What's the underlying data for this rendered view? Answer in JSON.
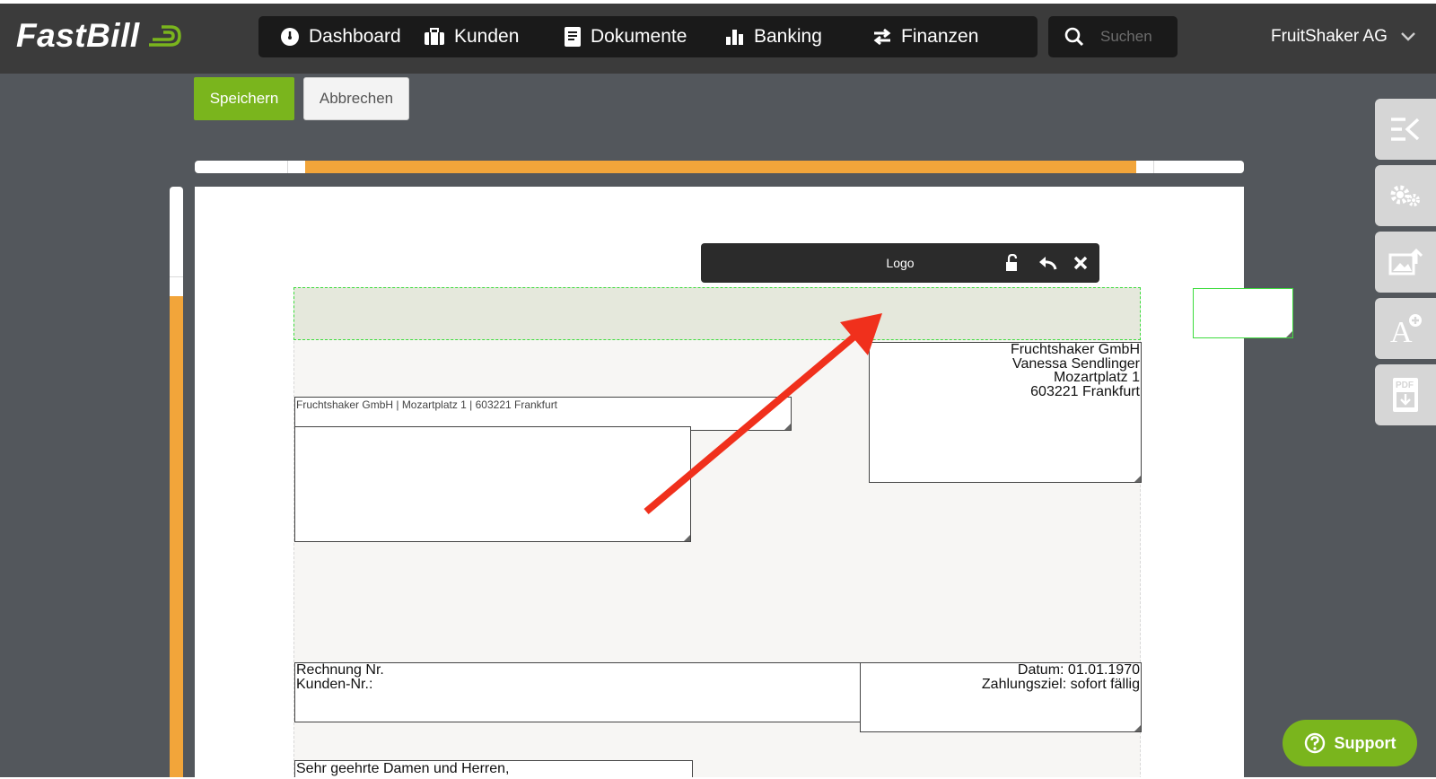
{
  "app": {
    "brand": "FastBill"
  },
  "nav": {
    "items": [
      {
        "label": "Dashboard",
        "icon": "dashboard-icon"
      },
      {
        "label": "Kunden",
        "icon": "briefcase-icon"
      },
      {
        "label": "Dokumente",
        "icon": "document-icon"
      },
      {
        "label": "Banking",
        "icon": "bar-chart-icon"
      },
      {
        "label": "Finanzen",
        "icon": "transfer-arrows-icon"
      }
    ],
    "search_placeholder": "Suchen",
    "account": "FruitShaker AG"
  },
  "toolbar": {
    "save_label": "Speichern",
    "cancel_label": "Abbrechen"
  },
  "element_toolbar": {
    "title": "Logo",
    "icons": [
      "unlock-icon",
      "undo-icon",
      "close-icon"
    ]
  },
  "document": {
    "sender_line": "Fruchtshaker GmbH | Mozartplatz 1 | 603221 Frankfurt",
    "recipient": [
      "Fruchtshaker GmbH",
      "Vanessa Sendlinger",
      "Mozartplatz 1",
      "603221 Frankfurt"
    ],
    "invoice_meta": [
      "Rechnung Nr.",
      "Kunden-Nr.:"
    ],
    "date_meta": [
      "Datum: 01.01.1970",
      "Zahlungsziel: sofort fällig"
    ],
    "greeting": "Sehr geehrte Damen und Herren,"
  },
  "side_tools": [
    "collapse-panel-icon",
    "settings-gears-icon",
    "image-upload-icon",
    "add-text-icon",
    "pdf-download-icon"
  ],
  "support": {
    "label": "Support",
    "icon": "help-circle-icon"
  },
  "colors": {
    "accent_green": "#7ab51d",
    "ruler_orange": "#f2a53a",
    "annotation_red": "#f0301c",
    "selection_green": "#3ddc3d"
  }
}
